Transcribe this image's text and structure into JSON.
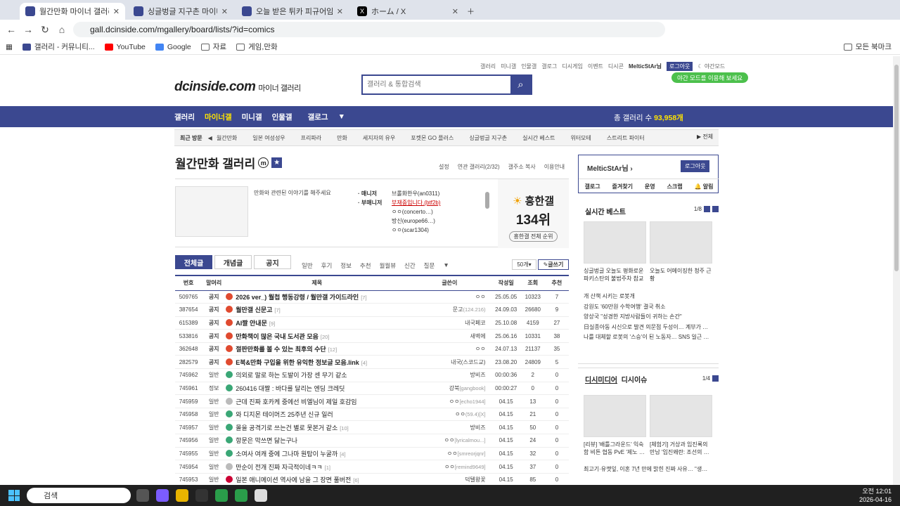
{
  "browser": {
    "tabs": [
      {
        "title": "월간만화 마이너 갤러리 - 커뮤",
        "active": true
      },
      {
        "title": "싱글벙글 지구촌 마이너 갤러리",
        "active": false
      },
      {
        "title": "오늘 받은 튀카 피규어임... - 특",
        "active": false
      },
      {
        "title": "ホーム / X",
        "active": false
      }
    ],
    "url": "gall.dcinside.com/mgallery/board/lists/?id=comics",
    "bookmarks": [
      "갤러리 - 커뮤니티...",
      "YouTube",
      "Google",
      "자료",
      "게임,만화"
    ],
    "all_bookmarks": "모든 북마크"
  },
  "site": {
    "topnav": [
      "갤러리",
      "미니갤",
      "인물갤",
      "갤로그",
      "디시게임",
      "이벤트",
      "디시콘"
    ],
    "user": "MelticStAr님",
    "logout": "로그아웃",
    "night": "야간모드",
    "night_tip": "야간 모드를 이용해 보세요",
    "logo": "dcinside.com",
    "logo_sub": "마이너 갤러리",
    "search_placeholder": "갤러리 & 통합검색",
    "gnb": [
      "갤러리",
      "마이너갤",
      "미니갤",
      "인물갤",
      "갤로그"
    ],
    "total_label": "총 갤러리 수",
    "total_value": "93,958개",
    "recent_label": "최근 방문",
    "recent": [
      "월간만화",
      "일본 여성성우",
      "프리파라",
      "만화",
      "세지자의 유우",
      "포켓몬 GO 플러스",
      "싱글벙글 지구촌",
      "실시간 베스트",
      "위터모테",
      "스트리트 파이터"
    ],
    "recent_all": "전체"
  },
  "gallery": {
    "title": "월간만화 갤러리",
    "links": [
      "설정",
      "연관 갤러리(2/32)",
      "갤주소 복사",
      "이용안내"
    ],
    "desc": "만화와 관련된 이야기를 해주세요",
    "manager_label": "· 매니저",
    "submanager_label": "· 부매니저",
    "manager": "브롤화한우(an0311)",
    "submanagers": [
      "부재중입니다.(btf2b)",
      "ㅇㅇ(concerto…)",
      "방신(europe66…)",
      "ㅇㅇ(scar1304)"
    ],
    "rank_title": "흥한갤",
    "rank_value": "134위",
    "rank_link": "흥한갤 전체 순위"
  },
  "board": {
    "tabs": [
      "전체글",
      "개념글",
      "공지"
    ],
    "heads": [
      "일반",
      "후기",
      "정보",
      "추천",
      "월월뷰",
      "신간",
      "질문"
    ],
    "list_size": "50개",
    "write": "글쓰기",
    "columns": [
      "번호",
      "말머리",
      "제목",
      "글쓴이",
      "작성일",
      "조회",
      "추천"
    ],
    "rows": [
      {
        "no": "509765",
        "head": "공지",
        "title": "2026 ver_) 월첩 행동강령 / 월만갤 가이드라인",
        "rep": "[7]",
        "writer": "ㅇㅇ",
        "ip": "",
        "date": "25.05.05",
        "views": "10323",
        "rec": "7",
        "icon": "n",
        "notice": true
      },
      {
        "no": "387654",
        "head": "공지",
        "title": "월만갤 신문고",
        "rep": "[7]",
        "writer": "문고",
        "ip": "(124.216)",
        "date": "24.09.03",
        "views": "26680",
        "rec": "9",
        "icon": "n",
        "notice": true
      },
      {
        "no": "615389",
        "head": "공지",
        "title": "AI짤 안내문",
        "rep": "[9]",
        "writer": "내국페코",
        "ip": "",
        "date": "25.10.08",
        "views": "4159",
        "rec": "27",
        "icon": "n",
        "notice": true
      },
      {
        "no": "533816",
        "head": "공지",
        "title": "만화책이 많은 국내 도서관 모음",
        "rep": "[20]",
        "writer": "새벽에",
        "ip": "",
        "date": "25.06.16",
        "views": "10331",
        "rec": "38",
        "icon": "n",
        "notice": true
      },
      {
        "no": "362648",
        "head": "공지",
        "title": "절판만화를 볼 수 있는 최후의 수단",
        "rep": "[12]",
        "writer": "ㅇㅇ",
        "ip": "",
        "date": "24.07.13",
        "views": "21137",
        "rec": "35",
        "icon": "n",
        "notice": true
      },
      {
        "no": "282579",
        "head": "공지",
        "title": "E북&만화 구입을 위한 유익한 정보글 모음.link",
        "rep": "[4]",
        "writer": "내국(스코드교)",
        "ip": "",
        "date": "23.08.20",
        "views": "24809",
        "rec": "5",
        "icon": "n",
        "notice": true
      },
      {
        "no": "745962",
        "head": "일반",
        "title": "의외로 말로 하는 도발이 가장 센 무기 같소",
        "rep": "",
        "writer": "방비즈",
        "ip": "",
        "date": "00:00:36",
        "views": "2",
        "rec": "0",
        "icon": "g",
        "notice": false
      },
      {
        "no": "745961",
        "head": "정보",
        "title": "260416 대짤 : 바다를 달리는 엔딩 크레딧",
        "rep": "",
        "writer": "강북",
        "ip": "[gangbook]",
        "date": "00:00:27",
        "views": "0",
        "rec": "0",
        "icon": "g",
        "notice": false
      },
      {
        "no": "745959",
        "head": "일반",
        "title": "근데 진짜 호카케 중에선 비엘님이 제일 호감임",
        "rep": "",
        "writer": "ㅇㅇ",
        "ip": "[echo1944]",
        "date": "04.15",
        "views": "13",
        "rec": "0",
        "icon": "p",
        "notice": false
      },
      {
        "no": "745958",
        "head": "일반",
        "title": "와 디지몬 테이머즈 25주년 신규 일러",
        "rep": "",
        "writer": "ㅇㅇ",
        "ip": "(59.4)[X]",
        "date": "04.15",
        "views": "21",
        "rec": "0",
        "icon": "g",
        "notice": false
      },
      {
        "no": "745957",
        "head": "일반",
        "title": "몰을 공격기로 쓰는건 별로 못본거 같소",
        "rep": "[10]",
        "writer": "방비즈",
        "ip": "",
        "date": "04.15",
        "views": "50",
        "rec": "0",
        "icon": "g",
        "notice": false
      },
      {
        "no": "745956",
        "head": "일반",
        "title": "항문은 막쓰면 닳는구나",
        "rep": "",
        "writer": "ㅇㅇ",
        "ip": "[lyricalmou...]",
        "date": "04.15",
        "views": "24",
        "rec": "0",
        "icon": "g",
        "notice": false
      },
      {
        "no": "745955",
        "head": "일반",
        "title": "소여사 여캐 중에 그나마 원탑이 누굴까",
        "rep": "[4]",
        "writer": "ㅇㅇ",
        "ip": "[smreorjqnr]",
        "date": "04.15",
        "views": "32",
        "rec": "0",
        "icon": "g",
        "notice": false
      },
      {
        "no": "745954",
        "head": "일반",
        "title": "만순이 전개 진짜 자극적이네ㅋㅋ",
        "rep": "[1]",
        "writer": "ㅇㅇ",
        "ip": "[remind9649]",
        "date": "04.15",
        "views": "37",
        "rec": "0",
        "icon": "p",
        "notice": false
      },
      {
        "no": "745953",
        "head": "일반",
        "title": "일본 애니메이션 역사에 남을 그 장면 풀버전",
        "rep": "[6]",
        "writer": "덕텔왕꽃",
        "ip": "",
        "date": "04.15",
        "views": "85",
        "rec": "0",
        "icon": "b",
        "notice": false
      }
    ]
  },
  "sidebar": {
    "user": "MelticStAr님",
    "logout": "로그아웃",
    "links": [
      "갤로그",
      "즐겨찾기",
      "운영",
      "스크랩",
      "알림"
    ],
    "best_title": "실시간 베스트",
    "best_page": "1/8",
    "best_caps": [
      "싱글벙글 오늘도 평화로운 파키스탄의 불법주차 참교",
      "오늘도 어메이징한 청주 근황"
    ],
    "best_list": [
      "개 산책 시키는 로봇개",
      "강원도 '60만원 수학여행' 결국 취소",
      "양상국 \"성경한 지방사람들이 귀하는 손간\"",
      "日실종아동 시신으로 발견 의문점 두성이… 계부가 …",
      "나를 대체할 로봇의 '스승'이 된 노동자… SNS 일근 …"
    ],
    "media_title": "디시미디어",
    "issue_title": "디시이슈",
    "media_page": "1/4",
    "media_caps": [
      "[리뷰] '배틀그라운드' 익숙함 비튼 협동 PvE '제노 …",
      "[체험기] 거상과 임진록의 만남 '임진왜란: 조선의 …"
    ],
    "media_list": [
      "최고기·유깻잎, 이혼 7년 만에 밝힌 진짜 사유… \"생…"
    ]
  },
  "taskbar": {
    "search": "검색",
    "time": "오전 12:01",
    "date": "2026-04-16"
  },
  "colors": {
    "brand": "#3b4890",
    "gnb_highlight": "#ffe400",
    "notice_icon": "#e04a2f",
    "general_icon": "#3aa776"
  }
}
